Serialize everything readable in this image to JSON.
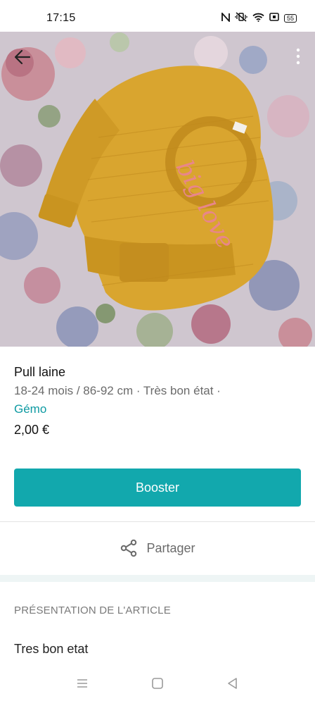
{
  "status_bar": {
    "time": "17:15",
    "battery": "55",
    "icons": [
      "nfc-icon",
      "vibrate-off-icon",
      "wifi-icon",
      "sim-icon",
      "battery-icon"
    ]
  },
  "item": {
    "title": "Pull laine",
    "meta": "18-24 mois / 86-92 cm · Très bon état ·",
    "brand": "Gémo",
    "price": "2,00 €"
  },
  "actions": {
    "booster_label": "Booster",
    "share_label": "Partager"
  },
  "section": {
    "title": "PRÉSENTATION DE L'ARTICLE",
    "description": "Tres bon etat"
  },
  "colors": {
    "accent": "#12a8ad",
    "link": "#0d9aa2",
    "sweater": "#d9a52f",
    "print": "#e8868a"
  }
}
